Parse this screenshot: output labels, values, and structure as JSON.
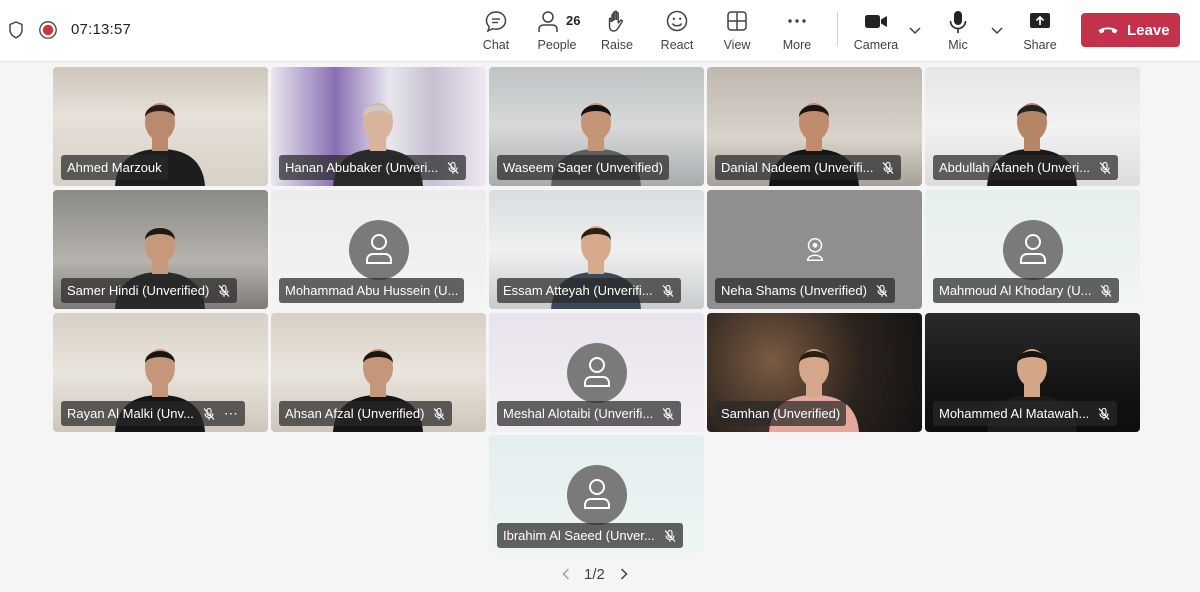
{
  "status": {
    "timer": "07:13:57"
  },
  "toolbar": {
    "chat": "Chat",
    "people": "People",
    "people_count": "26",
    "raise": "Raise",
    "react": "React",
    "view": "View",
    "more": "More",
    "camera": "Camera",
    "mic": "Mic",
    "share": "Share",
    "leave": "Leave"
  },
  "participants": [
    {
      "name": "Ahmed Marzouk",
      "video": true,
      "muted": false
    },
    {
      "name": "Hanan Abubaker (Unveri...",
      "video": true,
      "muted": true
    },
    {
      "name": "Waseem Saqer (Unverified)",
      "video": true,
      "muted": false
    },
    {
      "name": "Danial Nadeem (Unverifi...",
      "video": true,
      "muted": true
    },
    {
      "name": "Abdullah Afaneh (Unveri...",
      "video": true,
      "muted": true
    },
    {
      "name": "Samer Hindi (Unverified)",
      "video": true,
      "muted": true
    },
    {
      "name": "Mohammad Abu Hussein (U...",
      "video": false,
      "muted": false
    },
    {
      "name": "Essam Atteyah (Unverifi...",
      "video": true,
      "muted": true
    },
    {
      "name": "Neha Shams (Unverified)",
      "video": false,
      "muted": true
    },
    {
      "name": "Mahmoud Al Khodary (U...",
      "video": false,
      "muted": true
    },
    {
      "name": "Rayan Al Malki (Unv...",
      "video": true,
      "muted": true
    },
    {
      "name": "Ahsan Afzal (Unverified)",
      "video": true,
      "muted": true
    },
    {
      "name": "Meshal Alotaibi (Unverifi...",
      "video": false,
      "muted": true
    },
    {
      "name": "Samhan (Unverified)",
      "video": true,
      "muted": false
    },
    {
      "name": "Mohammed Al Matawah...",
      "video": true,
      "muted": true
    },
    {
      "name": "Ibrahim Al Saeed (Unver...",
      "video": false,
      "muted": true
    }
  ],
  "pager": {
    "label": "1/2"
  },
  "colors": {
    "leave": "#c4314b",
    "placeholder_avatar": "#7a7a7a",
    "recording": "#d13438"
  }
}
